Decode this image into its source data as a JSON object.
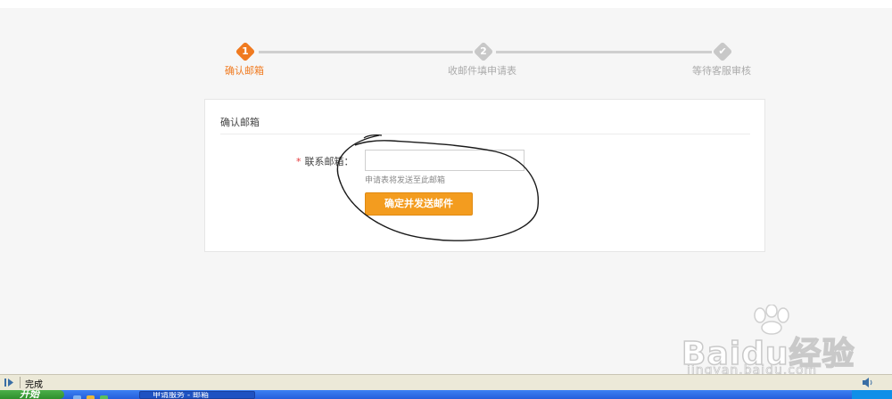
{
  "steps": [
    {
      "number": "1",
      "label": "确认邮箱",
      "state": "active"
    },
    {
      "number": "2",
      "label": "收邮件填申请表",
      "state": "pending"
    },
    {
      "number": "✔",
      "label": "等待客服审核",
      "state": "pending"
    }
  ],
  "card": {
    "title": "确认邮箱",
    "field_required_mark": "*",
    "field_label": "联系邮箱：",
    "email_value": "",
    "hint": "申请表将发送至此邮箱",
    "submit_label": "确定并发送邮件"
  },
  "watermark": {
    "brand": "Baidu经验",
    "sub": "jingyan.baidu.com"
  },
  "statusbar": {
    "text": "完成",
    "icon": "page-done-icon"
  },
  "taskbar": {
    "start_label": "开始",
    "window_label": "申请服务 - 邮箱"
  },
  "colors": {
    "accent": "#f07a1f",
    "button": "#f39c1f",
    "inactive": "#c8c8c8"
  }
}
